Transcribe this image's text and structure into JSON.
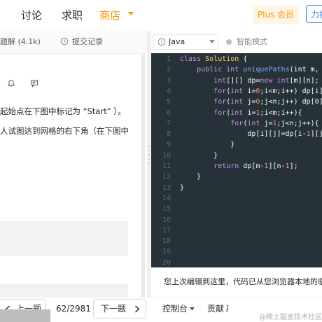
{
  "nav": {
    "discuss": "讨论",
    "jobs": "求职",
    "store": "商店",
    "plus_member": "Plus 会员",
    "power_button": "力扣"
  },
  "left_toolbar": {
    "solutions": "题解 (4.1k)",
    "submissions": "提交记录"
  },
  "description": {
    "line1": "起始点在下图中标记为 “Start” ）。",
    "line2": "人试图达到网格的右下角（在下图中"
  },
  "editor_toolbar": {
    "language": "Java",
    "smart_mode": "智能模式"
  },
  "code": {
    "line_numbers": [
      "1",
      "2",
      "3",
      "4",
      "5",
      "6",
      "7",
      "8",
      "9",
      "10",
      "11",
      "12",
      "13",
      "14",
      "15",
      "16",
      "17",
      "18",
      "19",
      "20"
    ]
  },
  "restore_message": "您上次编辑到这里，代码已从您浏览器本地的临时存储中恢复",
  "bottom": {
    "prev": "上一题",
    "progress": "62/2981",
    "next": "下一题",
    "console": "控制台",
    "contribute": "贡献",
    "watermark": "@稀土掘金技术社区"
  },
  "colors": {
    "accent_orange": "#ff9500",
    "accent_blue": "#2f80ed",
    "editor_bg": "#263238"
  }
}
